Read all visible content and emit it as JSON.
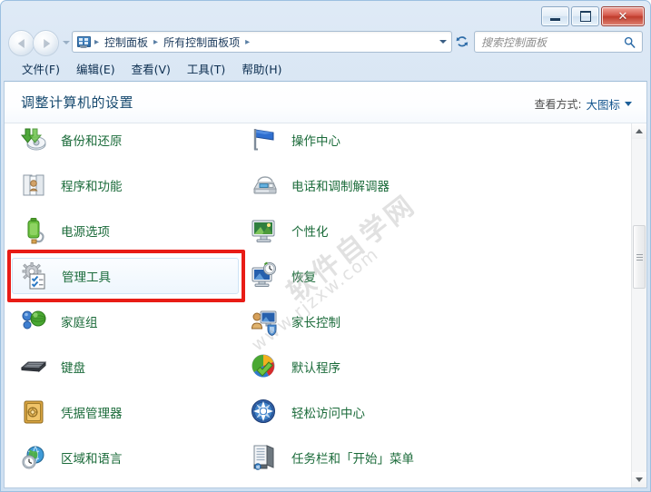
{
  "window": {
    "controls": {
      "minimize": "–",
      "maximize": "□",
      "close": "✕"
    }
  },
  "address": {
    "crumbs": [
      "控制面板",
      "所有控制面板项"
    ],
    "separator": "▸",
    "icon": "control-panel-icon"
  },
  "search": {
    "placeholder": "搜索控制面板",
    "icon": "search-icon"
  },
  "menu": {
    "items": [
      "文件(F)",
      "编辑(E)",
      "查看(V)",
      "工具(T)",
      "帮助(H)"
    ]
  },
  "content": {
    "title": "调整计算机的设置",
    "view_by_label": "查看方式:",
    "view_by_value": "大图标"
  },
  "watermark": {
    "line1": "软件自学网",
    "line2": "www.rjzxw.com"
  },
  "items": {
    "left": [
      {
        "label": "备份和还原",
        "icon": "backup-restore-icon",
        "highlighted": false
      },
      {
        "label": "程序和功能",
        "icon": "programs-features-icon",
        "highlighted": false
      },
      {
        "label": "电源选项",
        "icon": "power-options-icon",
        "highlighted": false
      },
      {
        "label": "管理工具",
        "icon": "administrative-tools-icon",
        "highlighted": true
      },
      {
        "label": "家庭组",
        "icon": "homegroup-icon",
        "highlighted": false
      },
      {
        "label": "键盘",
        "icon": "keyboard-icon",
        "highlighted": false
      },
      {
        "label": "凭据管理器",
        "icon": "credential-manager-icon",
        "highlighted": false
      },
      {
        "label": "区域和语言",
        "icon": "region-language-icon",
        "highlighted": false
      }
    ],
    "right": [
      {
        "label": "操作中心",
        "icon": "action-center-icon",
        "highlighted": false
      },
      {
        "label": "电话和调制解调器",
        "icon": "phone-modem-icon",
        "highlighted": false
      },
      {
        "label": "个性化",
        "icon": "personalization-icon",
        "highlighted": false
      },
      {
        "label": "恢复",
        "icon": "recovery-icon",
        "highlighted": false
      },
      {
        "label": "家长控制",
        "icon": "parental-controls-icon",
        "highlighted": false
      },
      {
        "label": "默认程序",
        "icon": "default-programs-icon",
        "highlighted": false
      },
      {
        "label": "轻松访问中心",
        "icon": "ease-of-access-icon",
        "highlighted": false
      },
      {
        "label": "任务栏和「开始」菜单",
        "icon": "taskbar-start-menu-icon",
        "highlighted": false
      }
    ]
  },
  "colors": {
    "highlight_box": "#e81c16",
    "item_label": "#1b6b3a",
    "page_title": "#15486e",
    "link": "#15568f"
  }
}
